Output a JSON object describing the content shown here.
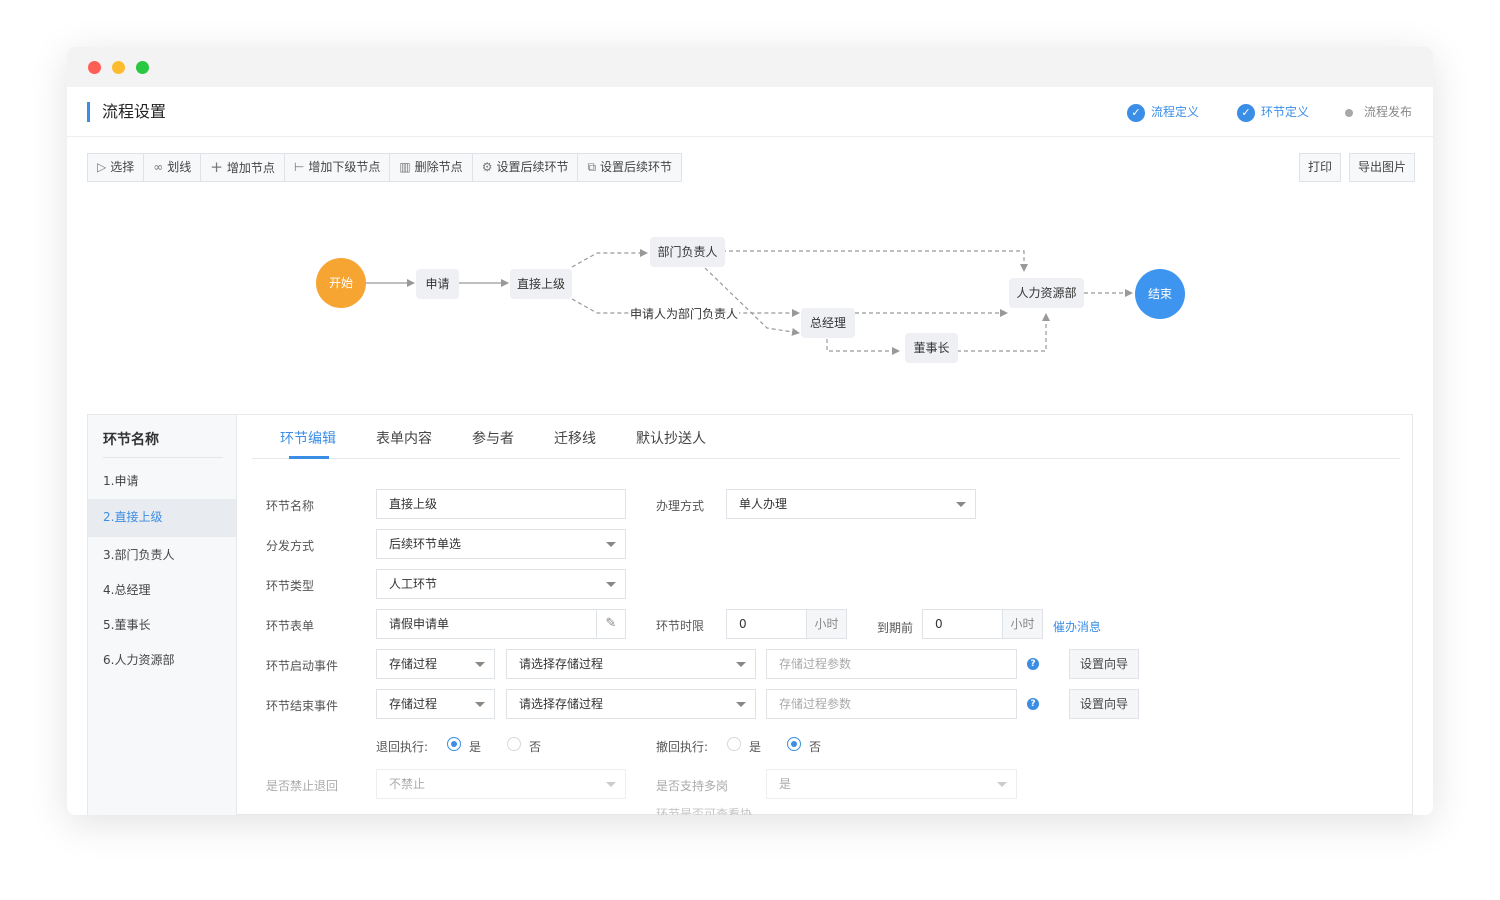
{
  "window": {
    "controls": [
      "close",
      "minimize",
      "maximize"
    ]
  },
  "header": {
    "title": "流程设置",
    "steps": [
      {
        "label": "流程定义",
        "status": "done"
      },
      {
        "label": "环节定义",
        "status": "done"
      },
      {
        "label": "流程发布",
        "status": "pending"
      }
    ]
  },
  "toolbar": {
    "items": [
      {
        "label": "选择",
        "icon": "pointer-icon"
      },
      {
        "label": "划线",
        "icon": "link-icon"
      },
      {
        "label": "增加节点",
        "icon": "plus-icon"
      },
      {
        "label": "增加下级节点",
        "icon": "tree-icon"
      },
      {
        "label": "删除节点",
        "icon": "trash-icon"
      },
      {
        "label": "设置后续环节",
        "icon": "gear-icon"
      },
      {
        "label": "设置后续环节",
        "icon": "copy-icon"
      }
    ],
    "print_label": "打印",
    "export_label": "导出图片"
  },
  "flow": {
    "start": "开始",
    "end": "结束",
    "nodes": {
      "apply": "申请",
      "supervisor": "直接上级",
      "dept_head": "部门负责人",
      "gm": "总经理",
      "hr": "人力资源部",
      "chairman": "董事长"
    },
    "edge_label": "申请人为部门负责人"
  },
  "sidebar": {
    "title": "环节名称",
    "items": [
      "1.申请",
      "2.直接上级",
      "3.部门负责人",
      "4.总经理",
      "5.董事长",
      "6.人力资源部"
    ],
    "active_index": 1
  },
  "tabs": [
    "环节编辑",
    "表单内容",
    "参与者",
    "迁移线",
    "默认抄送人"
  ],
  "form": {
    "node_name": {
      "label": "环节名称",
      "value": "直接上级"
    },
    "handle_mode": {
      "label": "办理方式",
      "value": "单人办理"
    },
    "dispatch": {
      "label": "分发方式",
      "value": "后续环节单选"
    },
    "node_type": {
      "label": "环节类型",
      "value": "人工环节"
    },
    "node_form": {
      "label": "环节表单",
      "value": "请假申请单"
    },
    "time_limit": {
      "label": "环节时限",
      "value": "0",
      "unit": "小时"
    },
    "before_due": {
      "label": "到期前",
      "value": "0",
      "unit": "小时",
      "link": "催办消息"
    },
    "start_event": {
      "label": "环节启动事件",
      "type": "存储过程",
      "proc_placeholder": "请选择存储过程",
      "param_placeholder": "存储过程参数",
      "button": "设置向导"
    },
    "end_event": {
      "label": "环节结束事件",
      "type": "存储过程",
      "proc_placeholder": "请选择存储过程",
      "param_placeholder": "存储过程参数",
      "button": "设置向导"
    },
    "return_exec": {
      "label": "退回执行:",
      "yes": "是",
      "no": "否",
      "selected": "是"
    },
    "withdraw_exec": {
      "label": "撤回执行:",
      "yes": "是",
      "no": "否",
      "selected": "否"
    },
    "forbid_return": {
      "label": "是否禁止退回",
      "value": "不禁止"
    },
    "multi_post": {
      "label": "是否支持多岗",
      "value": "是"
    },
    "view_label": "环节是否可查看协"
  },
  "colors": {
    "accent": "#3a8ee6",
    "start": "#f7a532",
    "end": "#3d95f0",
    "close": "#fd5f57",
    "minimize": "#fdbc2e",
    "maximize": "#28c840"
  }
}
